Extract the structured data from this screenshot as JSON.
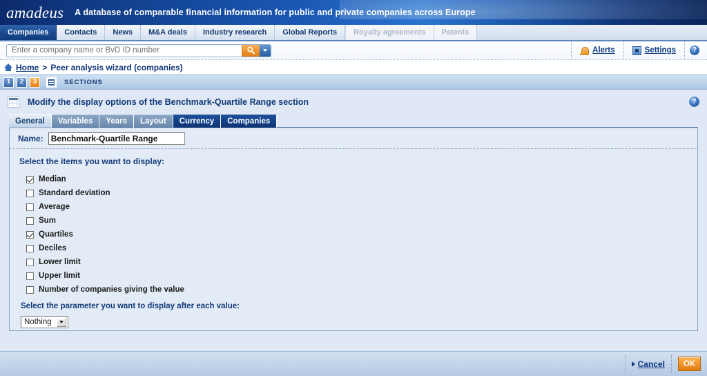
{
  "banner": {
    "logo": "amadeus",
    "tagline": "A database of comparable financial information for public and private companies across Europe"
  },
  "nav": {
    "tabs": [
      {
        "label": "Companies",
        "state": "active"
      },
      {
        "label": "Contacts",
        "state": "normal"
      },
      {
        "label": "News",
        "state": "normal"
      },
      {
        "label": "M&A deals",
        "state": "normal"
      },
      {
        "label": "Industry research",
        "state": "normal"
      },
      {
        "label": "Global Reports",
        "state": "normal"
      },
      {
        "label": "Royalty agreements",
        "state": "disabled"
      },
      {
        "label": "Patents",
        "state": "disabled"
      }
    ]
  },
  "search": {
    "placeholder": "Enter a company name or BvD ID number",
    "value": "",
    "go_icon": "magnifier-icon",
    "dropdown_icon": "chevron-down-icon"
  },
  "utilities": {
    "alerts_label": "Alerts",
    "alerts_icon": "bell-icon",
    "settings_label": "Settings",
    "settings_icon": "settings-icon",
    "help_label": "?"
  },
  "breadcrumb": {
    "home_icon": "home-icon",
    "home": "Home",
    "separator": ">",
    "current": "Peer analysis wizard (companies)"
  },
  "sections_bar": {
    "steps": [
      {
        "label": "1",
        "state": "done"
      },
      {
        "label": "2",
        "state": "done"
      },
      {
        "label": "3",
        "state": "current"
      }
    ],
    "sections_icon": "list-icon",
    "label": "SECTIONS"
  },
  "page": {
    "icon": "table-grid-icon",
    "title": "Modify the display options of the Benchmark-Quartile Range section",
    "help_label": "?"
  },
  "subtabs": [
    {
      "label": "General",
      "state": "selected"
    },
    {
      "label": "Variables",
      "state": "normal"
    },
    {
      "label": "Years",
      "state": "normal"
    },
    {
      "label": "Layout",
      "state": "normal"
    },
    {
      "label": "Currency",
      "state": "dark"
    },
    {
      "label": "Companies",
      "state": "dark"
    }
  ],
  "form": {
    "name_label": "Name:",
    "name_value": "Benchmark-Quartile Range",
    "items_heading": "Select the items you want to display:",
    "items": [
      {
        "label": "Median",
        "checked": true
      },
      {
        "label": "Standard deviation",
        "checked": false
      },
      {
        "label": "Average",
        "checked": false
      },
      {
        "label": "Sum",
        "checked": false
      },
      {
        "label": "Quartiles",
        "checked": true
      },
      {
        "label": "Deciles",
        "checked": false
      },
      {
        "label": "Lower limit",
        "checked": false
      },
      {
        "label": "Upper limit",
        "checked": false
      },
      {
        "label": "Number of companies giving the value",
        "checked": false
      }
    ],
    "parameter_heading": "Select the parameter you want to display after each value:",
    "parameter_value": "Nothing"
  },
  "footer": {
    "cancel_label": "Cancel",
    "ok_label": "OK"
  },
  "colors": {
    "brand_blue": "#15479a",
    "accent_orange": "#ef9530",
    "panel_bg": "#e3ebf6",
    "link_blue": "#0d3a82"
  }
}
